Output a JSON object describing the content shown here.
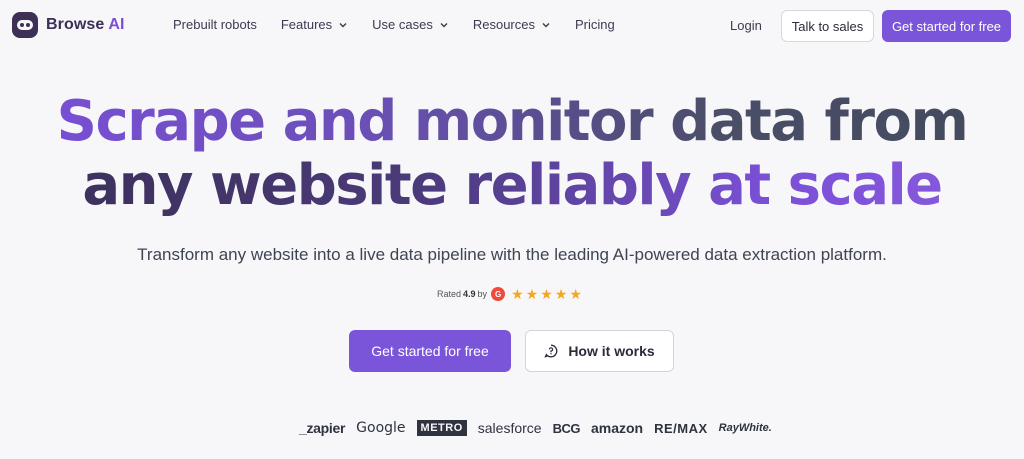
{
  "nav": {
    "logo_text": "Browse",
    "logo_ai": "AI",
    "items": [
      {
        "label": "Prebuilt robots",
        "dropdown": false
      },
      {
        "label": "Features",
        "dropdown": true
      },
      {
        "label": "Use cases",
        "dropdown": true
      },
      {
        "label": "Resources",
        "dropdown": true
      },
      {
        "label": "Pricing",
        "dropdown": false
      }
    ],
    "login": "Login",
    "talk_to_sales": "Talk to sales",
    "get_started": "Get started for free"
  },
  "hero": {
    "title_line1": "Scrape and monitor data from",
    "title_line2": "any website reliably at scale",
    "subtitle": "Transform any website into a live data pipeline with the leading AI-powered data extraction platform.",
    "rating_prefix": "Rated",
    "rating_value": "4.9",
    "rating_by": "by",
    "rating_badge": "G",
    "stars": 5,
    "cta_primary": "Get started for free",
    "cta_secondary": "How it works"
  },
  "logos": [
    "_zapier",
    "Google",
    "METRO",
    "salesforce",
    "BCG",
    "amazon",
    "RE/MAX",
    "RayWhite."
  ],
  "colors": {
    "accent": "#7b55d9",
    "dark": "#3d2f55",
    "star": "#f5a623",
    "g2": "#ef4a3a"
  }
}
